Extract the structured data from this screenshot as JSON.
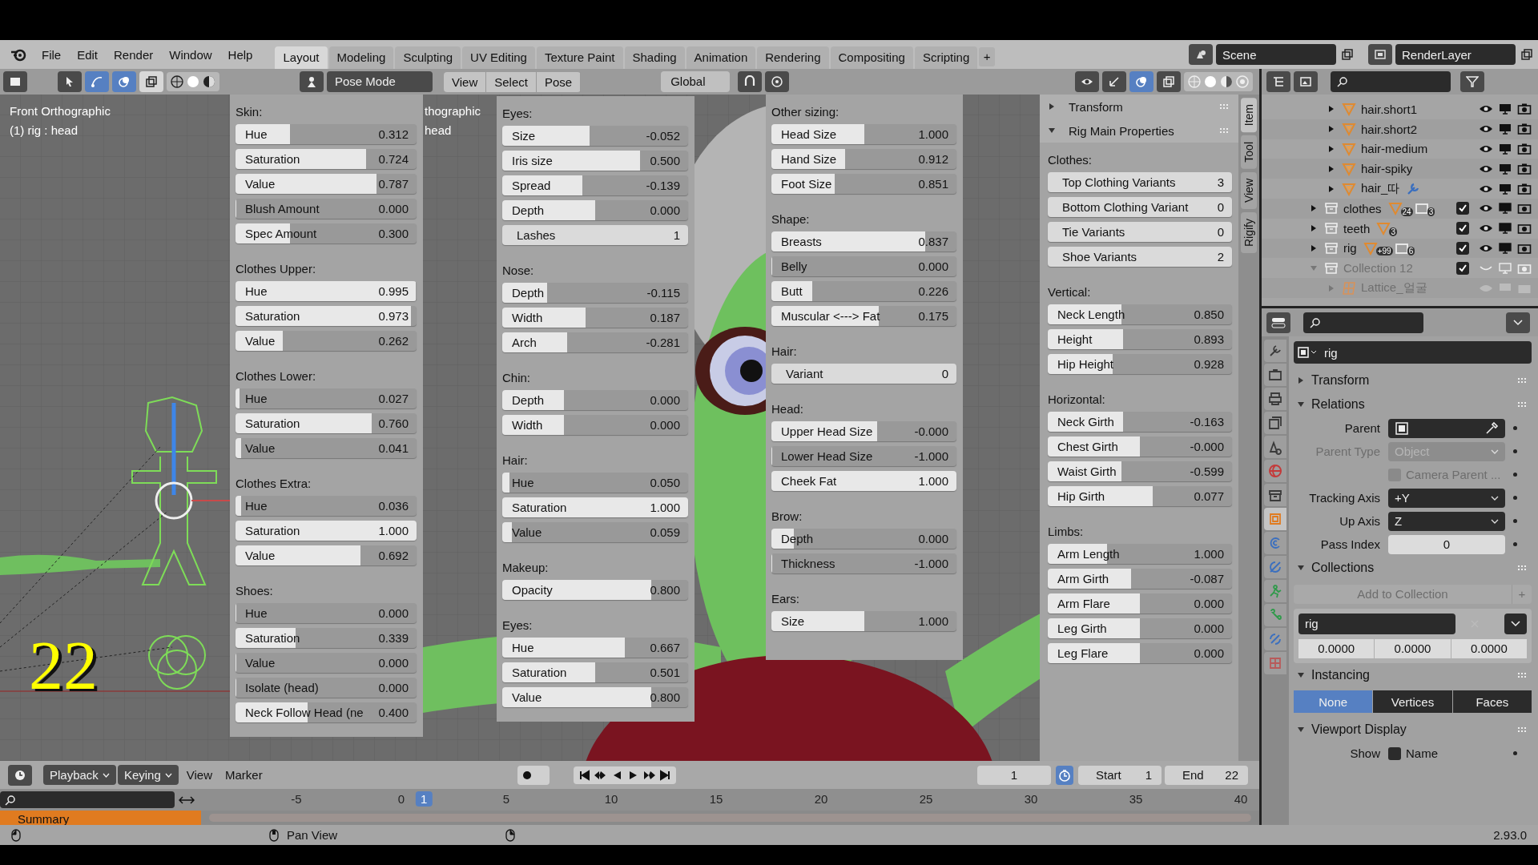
{
  "menu": {
    "items": [
      "File",
      "Edit",
      "Render",
      "Window",
      "Help"
    ]
  },
  "workspaces": [
    {
      "label": "Layout",
      "selected": true
    },
    {
      "label": "Modeling",
      "selected": false
    },
    {
      "label": "Sculpting",
      "selected": false
    },
    {
      "label": "UV Editing",
      "selected": false
    },
    {
      "label": "Texture Paint",
      "selected": false
    },
    {
      "label": "Shading",
      "selected": false
    },
    {
      "label": "Animation",
      "selected": false
    },
    {
      "label": "Rendering",
      "selected": false
    },
    {
      "label": "Compositing",
      "selected": false
    },
    {
      "label": "Scripting",
      "selected": false
    }
  ],
  "add_workspace": "+",
  "scene": {
    "value": "Scene"
  },
  "view_layer": {
    "value": "RenderLayer"
  },
  "viewport_header": {
    "mode": "Pose Mode",
    "menus": [
      "View",
      "Select",
      "Pose"
    ],
    "orientation": "Global"
  },
  "viewport": {
    "view_name": "Front Orthographic",
    "active": "(1) rig : head",
    "second_view_name": "thographic",
    "second_active": "head",
    "frame_caption": "22"
  },
  "panels": [
    {
      "sections": [
        {
          "title": "Skin:",
          "rows": [
            {
              "kind": "slider",
              "label": "Hue",
              "value": "0.312",
              "level": 0.3
            },
            {
              "kind": "slider",
              "label": "Saturation",
              "value": "0.724",
              "level": 0.72
            },
            {
              "kind": "slider",
              "label": "Value",
              "value": "0.787",
              "level": 0.78
            },
            {
              "kind": "slider",
              "label": "Blush Amount",
              "value": "0.000",
              "level": 0
            },
            {
              "kind": "slider",
              "label": "Spec Amount",
              "value": "0.300",
              "level": 0.3
            }
          ]
        },
        {
          "title": "Clothes Upper:",
          "rows": [
            {
              "kind": "slider",
              "label": "Hue",
              "value": "0.995",
              "level": 0.995
            },
            {
              "kind": "slider",
              "label": "Saturation",
              "value": "0.973",
              "level": 0.97
            },
            {
              "kind": "slider",
              "label": "Value",
              "value": "0.262",
              "level": 0.26
            }
          ]
        },
        {
          "title": "Clothes Lower:",
          "rows": [
            {
              "kind": "slider",
              "label": "Hue",
              "value": "0.027",
              "level": 0.02
            },
            {
              "kind": "slider",
              "label": "Saturation",
              "value": "0.760",
              "level": 0.75
            },
            {
              "kind": "slider",
              "label": "Value",
              "value": "0.041",
              "level": 0.03
            }
          ]
        },
        {
          "title": "Clothes Extra:",
          "rows": [
            {
              "kind": "slider",
              "label": "Hue",
              "value": "0.036",
              "level": 0.03
            },
            {
              "kind": "slider",
              "label": "Saturation",
              "value": "1.000",
              "level": 1
            },
            {
              "kind": "slider",
              "label": "Value",
              "value": "0.692",
              "level": 0.69
            }
          ]
        },
        {
          "title": "Shoes:",
          "rows": [
            {
              "kind": "slider",
              "label": "Hue",
              "value": "0.000",
              "level": 0
            },
            {
              "kind": "slider",
              "label": "Saturation",
              "value": "0.339",
              "level": 0.33
            },
            {
              "kind": "slider",
              "label": "Value",
              "value": "0.000",
              "level": 0
            },
            {
              "kind": "slider",
              "label": "Isolate (head)",
              "value": "0.000",
              "level": 0
            },
            {
              "kind": "slider",
              "label": "Neck Follow Head (ne",
              "value": "0.400",
              "level": 0.4
            }
          ]
        }
      ]
    },
    {
      "sections": [
        {
          "title": "Eyes:",
          "rows": [
            {
              "kind": "slider",
              "label": "Size",
              "value": "-0.052",
              "level": 0.47
            },
            {
              "kind": "slider",
              "label": "Iris size",
              "value": "0.500",
              "level": 0.74
            },
            {
              "kind": "slider",
              "label": "Spread",
              "value": "-0.139",
              "level": 0.43
            },
            {
              "kind": "slider",
              "label": "Depth",
              "value": "0.000",
              "level": 0.5
            },
            {
              "kind": "int",
              "label": "Lashes",
              "value": "1"
            }
          ]
        },
        {
          "title": "Nose:",
          "rows": [
            {
              "kind": "slider",
              "label": "Depth",
              "value": "-0.115",
              "level": 0.24
            },
            {
              "kind": "slider",
              "label": "Width",
              "value": "0.187",
              "level": 0.45
            },
            {
              "kind": "slider",
              "label": "Arch",
              "value": "-0.281",
              "level": 0.35
            }
          ]
        },
        {
          "title": "Chin:",
          "rows": [
            {
              "kind": "slider",
              "label": "Depth",
              "value": "0.000",
              "level": 0.33
            },
            {
              "kind": "slider",
              "label": "Width",
              "value": "0.000",
              "level": 0.33
            }
          ]
        },
        {
          "title": "Hair:",
          "rows": [
            {
              "kind": "slider",
              "label": "Hue",
              "value": "0.050",
              "level": 0.04
            },
            {
              "kind": "slider",
              "label": "Saturation",
              "value": "1.000",
              "level": 1
            },
            {
              "kind": "slider",
              "label": "Value",
              "value": "0.059",
              "level": 0.05
            }
          ]
        },
        {
          "title": "Makeup:",
          "rows": [
            {
              "kind": "slider",
              "label": "Opacity",
              "value": "0.800",
              "level": 0.8
            }
          ]
        },
        {
          "title": "Eyes:",
          "rows": [
            {
              "kind": "slider",
              "label": "Hue",
              "value": "0.667",
              "level": 0.66
            },
            {
              "kind": "slider",
              "label": "Saturation",
              "value": "0.501",
              "level": 0.5
            },
            {
              "kind": "slider",
              "label": "Value",
              "value": "0.800",
              "level": 0.8
            }
          ]
        }
      ]
    },
    {
      "sections": [
        {
          "title": "Other sizing:",
          "rows": [
            {
              "kind": "slider",
              "label": "Head Size",
              "value": "1.000",
              "level": 0.5
            },
            {
              "kind": "slider",
              "label": "Hand Size",
              "value": "0.912",
              "level": 0.4
            },
            {
              "kind": "slider",
              "label": "Foot Size",
              "value": "0.851",
              "level": 0.34
            }
          ]
        },
        {
          "title": "Shape:",
          "rows": [
            {
              "kind": "slider",
              "label": "Breasts",
              "value": "0.837",
              "level": 0.83
            },
            {
              "kind": "slider",
              "label": "Belly",
              "value": "0.000",
              "level": 0
            },
            {
              "kind": "slider",
              "label": "Butt",
              "value": "0.226",
              "level": 0.22
            },
            {
              "kind": "slider",
              "label": "Muscular <---> Fat",
              "value": "0.175",
              "level": 0.58
            }
          ]
        },
        {
          "title": "Hair:",
          "rows": [
            {
              "kind": "int",
              "label": "Variant",
              "value": "0"
            }
          ]
        },
        {
          "title": "Head:",
          "rows": [
            {
              "kind": "slider",
              "label": "Upper Head Size",
              "value": "-0.000",
              "level": 0.57
            },
            {
              "kind": "slider",
              "label": "Lower Head Size",
              "value": "-1.000",
              "level": 0
            },
            {
              "kind": "slider",
              "label": "Cheek Fat",
              "value": "1.000",
              "level": 1
            }
          ]
        },
        {
          "title": "Brow:",
          "rows": [
            {
              "kind": "slider",
              "label": "Depth",
              "value": "0.000",
              "level": 0.12
            },
            {
              "kind": "slider",
              "label": "Thickness",
              "value": "-1.000",
              "level": 0
            }
          ]
        },
        {
          "title": "Ears:",
          "rows": [
            {
              "kind": "slider",
              "label": "Size",
              "value": "1.000",
              "level": 0.5
            }
          ]
        }
      ]
    }
  ],
  "sidebar": {
    "headers": [
      {
        "label": "Transform",
        "expanded": false
      },
      {
        "label": "Rig Main Properties",
        "expanded": true
      }
    ],
    "sections": [
      {
        "title": "Clothes:",
        "rows": [
          {
            "kind": "int",
            "label": "Top Clothing Variants",
            "value": "3"
          },
          {
            "kind": "int",
            "label": "Bottom Clothing Variant",
            "value": "0"
          },
          {
            "kind": "int",
            "label": "Tie Variants",
            "value": "0"
          },
          {
            "kind": "int",
            "label": "Shoe Variants",
            "value": "2"
          }
        ]
      },
      {
        "title": "Vertical:",
        "rows": [
          {
            "kind": "slider",
            "label": "Neck Length",
            "value": "0.850",
            "level": 0.4
          },
          {
            "kind": "slider",
            "label": "Height",
            "value": "0.893",
            "level": 0.41
          },
          {
            "kind": "slider",
            "label": "Hip Height",
            "value": "0.928",
            "level": 0.35
          }
        ]
      },
      {
        "title": "Horizontal:",
        "rows": [
          {
            "kind": "slider",
            "label": "Neck Girth",
            "value": "-0.163",
            "level": 0.41
          },
          {
            "kind": "slider",
            "label": "Chest Girth",
            "value": "-0.000",
            "level": 0.5
          },
          {
            "kind": "slider",
            "label": "Waist Girth",
            "value": "-0.599",
            "level": 0.4
          },
          {
            "kind": "slider",
            "label": "Hip Girth",
            "value": "0.077",
            "level": 0.57
          }
        ]
      },
      {
        "title": "Limbs:",
        "rows": [
          {
            "kind": "slider",
            "label": "Arm Length",
            "value": "1.000",
            "level": 0.32
          },
          {
            "kind": "slider",
            "label": "Arm Girth",
            "value": "-0.087",
            "level": 0.45
          },
          {
            "kind": "slider",
            "label": "Arm Flare",
            "value": "0.000",
            "level": 0.5
          },
          {
            "kind": "slider",
            "label": "Leg Girth",
            "value": "0.000",
            "level": 0.5
          },
          {
            "kind": "slider",
            "label": "Leg Flare",
            "value": "0.000",
            "level": 0.5
          }
        ]
      }
    ],
    "tabs": [
      {
        "label": "Item",
        "selected": true
      },
      {
        "label": "Tool",
        "selected": false
      },
      {
        "label": "View",
        "selected": false
      },
      {
        "label": "Rigify",
        "selected": false
      }
    ]
  },
  "outliner": {
    "objects": [
      {
        "name": "hair.short1",
        "expanded": false,
        "modifier": false
      },
      {
        "name": "hair.short2",
        "expanded": false,
        "modifier": false
      },
      {
        "name": "hair-medium",
        "expanded": false,
        "modifier": false
      },
      {
        "name": "hair-spiky",
        "expanded": false,
        "modifier": false
      },
      {
        "name": "hair_따",
        "expanded": false,
        "modifier": true
      }
    ],
    "collections": [
      {
        "name": "clothes",
        "expanded": false,
        "checked": true,
        "disabled": false,
        "badges": [
          "24",
          "3"
        ]
      },
      {
        "name": "teeth",
        "expanded": false,
        "checked": true,
        "disabled": false,
        "badges": [
          "3"
        ]
      },
      {
        "name": "rig",
        "expanded": false,
        "checked": true,
        "disabled": false,
        "badges": [
          "+99",
          "6"
        ]
      },
      {
        "name": "Collection 12",
        "expanded": true,
        "checked": true,
        "disabled": true,
        "children": [
          {
            "name": "Lattice_얼굴",
            "expanded": false,
            "disabled": true
          }
        ]
      }
    ]
  },
  "properties": {
    "tabs": [
      {
        "selected": false
      },
      {
        "selected": false
      },
      {
        "selected": false
      },
      {
        "selected": false
      },
      {
        "selected": false
      },
      {
        "selected": false
      },
      {
        "selected": false
      },
      {
        "selected": true
      },
      {
        "selected": false
      },
      {
        "selected": false
      },
      {
        "selected": false
      },
      {
        "selected": false
      },
      {
        "selected": false
      },
      {
        "selected": false
      }
    ],
    "object_name": "rig",
    "transform": {
      "label": "Transform",
      "expanded": false
    },
    "relations": {
      "label": "Relations",
      "expanded": true,
      "fields": [
        {
          "kind": "object",
          "label": "Parent",
          "disabled": false
        },
        {
          "kind": "select",
          "label": "Parent Type",
          "value": "Object",
          "disabled": true
        },
        {
          "kind": "check",
          "label": "Camera Parent ...",
          "checked": false,
          "disabled": true
        },
        {
          "kind": "select",
          "label": "Tracking Axis",
          "value": "+Y",
          "disabled": false
        },
        {
          "kind": "select",
          "label": "Up Axis",
          "value": "Z",
          "disabled": false
        },
        {
          "kind": "number",
          "label": "Pass Index",
          "value": "0",
          "disabled": false
        }
      ]
    },
    "collections": {
      "label": "Collections",
      "expanded": true,
      "add_button": "Add to Collection",
      "add_icon": "+",
      "collection": "rig",
      "offsets": [
        "0.0000",
        "0.0000",
        "0.0000"
      ]
    },
    "instancing": {
      "label": "Instancing",
      "expanded": true,
      "options": [
        {
          "label": "None",
          "selected": true
        },
        {
          "label": "Vertices",
          "selected": false
        },
        {
          "label": "Faces",
          "selected": false
        }
      ]
    },
    "viewport_display": {
      "label": "Viewport Display",
      "expanded": true,
      "show_label": "Show",
      "name_label": "Name",
      "name_checked": false
    }
  },
  "timeline": {
    "menus": [
      {
        "label": "Playback",
        "dropdown": true
      },
      {
        "label": "Keying",
        "dropdown": true
      },
      {
        "label": "View",
        "dropdown": false
      },
      {
        "label": "Marker",
        "dropdown": false
      }
    ],
    "current_frame": "1",
    "start_label": "Start",
    "start": "1",
    "end_label": "End",
    "end": "22",
    "ruler": [
      "-5",
      "0",
      "5",
      "10",
      "15",
      "20",
      "25",
      "30",
      "35",
      "40"
    ],
    "playhead": "1",
    "summary": "Summary"
  },
  "status_bar": {
    "hint": "Pan View",
    "version": "2.93.0"
  }
}
